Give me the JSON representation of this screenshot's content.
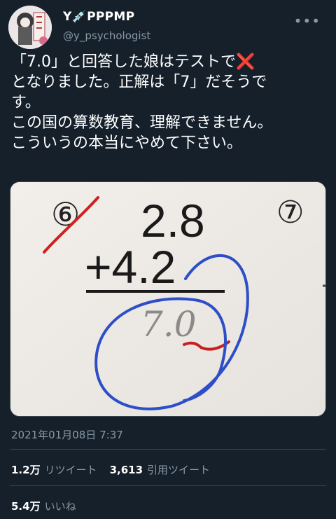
{
  "user": {
    "display_name": "Y💉PPPMP",
    "handle": "@y_psychologist",
    "more_icon": "more-horizontal-icon"
  },
  "tweet": {
    "line1": "「7.0」と回答した娘はテストで",
    "line1_mark": "❌",
    "line2": "となりました。正解は「7」だそうで",
    "line3": "す。",
    "line4": "この国の算数教育、理解できません。",
    "line5": "こういうの本当にやめて下さい。"
  },
  "photo": {
    "problem_number_left": "⑥",
    "problem_number_right": "⑦",
    "top_number": "2.8",
    "bottom_number": "+4.2",
    "answer": "7.0"
  },
  "timestamp": "2021年01月08日 7:37",
  "stats": {
    "retweets_count": "1.2万",
    "retweets_label": "リツイート",
    "quotes_count": "3,613",
    "quotes_label": "引用ツイート",
    "likes_count": "5.4万",
    "likes_label": "いいね"
  },
  "colors": {
    "background": "#15202b",
    "secondary_text": "#8899a6",
    "divider": "#38444d",
    "red_mark": "#dd2e44",
    "blue_circle": "#2d4ec8"
  }
}
